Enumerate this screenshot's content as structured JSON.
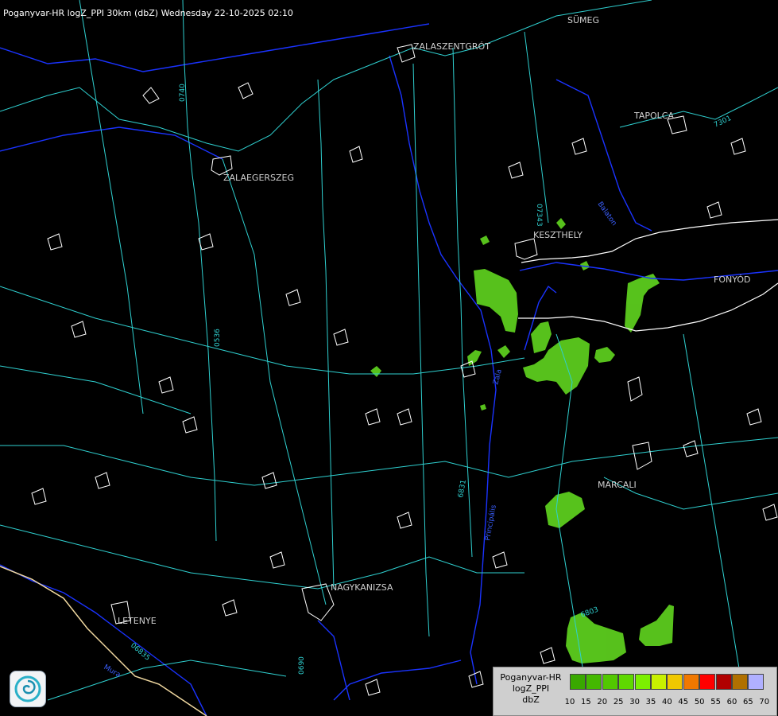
{
  "title": "Poganyvar-HR logZ_PPI 30km (dbZ) Wednesday 22-10-2025 02:10",
  "cities": [
    {
      "name": "SÜMEG"
    },
    {
      "name": "ZALASZENTGRÓT"
    },
    {
      "name": "TAPOLCA"
    },
    {
      "name": "ZALAEGERSZEG"
    },
    {
      "name": "KESZTHELY"
    },
    {
      "name": "FONYÓD"
    },
    {
      "name": "MARCALI"
    },
    {
      "name": "NAGYKANIZSA"
    },
    {
      "name": "LETENYE"
    }
  ],
  "road_numbers": [
    "0740",
    "07343",
    "7301",
    "0536",
    "6831",
    "6803",
    "06835",
    "0690"
  ],
  "river_names": [
    "Zala",
    "Balaton",
    "Principális",
    "Mura"
  ],
  "legend": {
    "source": "Poganyvar-HR",
    "product": "logZ_PPI",
    "unit": "dbZ",
    "levels": [
      {
        "value": "10",
        "color": "#39a800"
      },
      {
        "value": "15",
        "color": "#44b800"
      },
      {
        "value": "20",
        "color": "#52c800"
      },
      {
        "value": "25",
        "color": "#5fd800"
      },
      {
        "value": "30",
        "color": "#7cf000"
      },
      {
        "value": "35",
        "color": "#c8f000"
      },
      {
        "value": "40",
        "color": "#f0c800"
      },
      {
        "value": "45",
        "color": "#f07800"
      },
      {
        "value": "50",
        "color": "#ff0000"
      },
      {
        "value": "55",
        "color": "#b00000"
      },
      {
        "value": "60",
        "color": "#b07000"
      },
      {
        "value": "65",
        "color": "#a000ff"
      },
      {
        "value": "70",
        "color": "#b0b0ff"
      }
    ]
  },
  "colors": {
    "road": "#2fd0d0",
    "border": "#ffffff",
    "river": "#1a33ff",
    "echo": "#5ccc1e",
    "state_border": "#f0d8a0"
  },
  "logo_icon": "weather-service-swirl-icon"
}
